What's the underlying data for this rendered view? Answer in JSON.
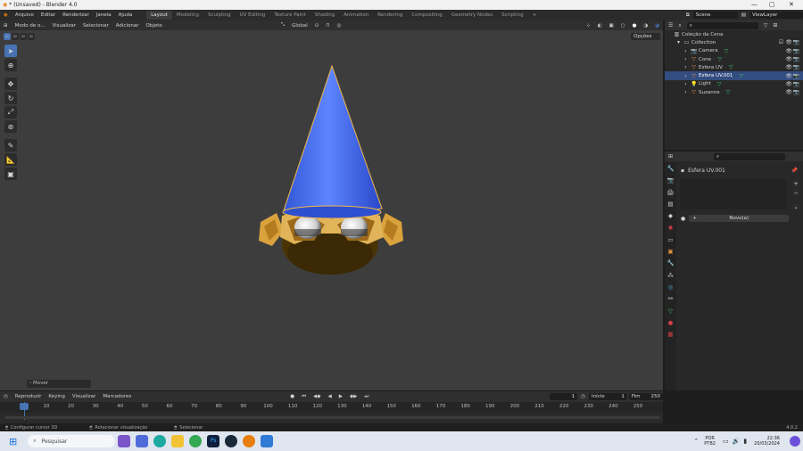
{
  "window": {
    "title": "* (Unsaved) - Blender 4.0"
  },
  "menu": [
    "Arquivo",
    "Editar",
    "Renderizar",
    "Janela",
    "Ajuda"
  ],
  "workspaces": [
    "Layout",
    "Modeling",
    "Sculpting",
    "UV Editing",
    "Texture Paint",
    "Shading",
    "Animation",
    "Rendering",
    "Compositing",
    "Geometry Nodes",
    "Scripting"
  ],
  "active_workspace": "Layout",
  "scene": {
    "label": "Scene",
    "viewlayer": "ViewLayer"
  },
  "viewport_header": {
    "mode": "Modo de o...",
    "items": [
      "Visualizar",
      "Selecionar",
      "Adicionar",
      "Objeto"
    ],
    "orientation": "Global",
    "options": "Opções"
  },
  "operator_panel": "Mover",
  "outliner": {
    "root": "Coleção da Cena",
    "collection": "Collection",
    "items": [
      {
        "name": "Camera",
        "icon": "camera-icon",
        "color": "#e0923a"
      },
      {
        "name": "Cone",
        "icon": "mesh-icon",
        "color": "#e0923a"
      },
      {
        "name": "Esfera UV",
        "icon": "mesh-icon",
        "color": "#e0923a"
      },
      {
        "name": "Esfera UV.001",
        "icon": "mesh-icon",
        "color": "#e0923a",
        "selected": true
      },
      {
        "name": "Light",
        "icon": "light-icon",
        "color": "#e0923a"
      },
      {
        "name": "Suzanne",
        "icon": "mesh-icon",
        "color": "#e0923a"
      }
    ]
  },
  "properties": {
    "object_name": "Esfera UV.001",
    "new_button": "Novo(a)"
  },
  "timeline": {
    "items": [
      "Reproduzir",
      "Keying",
      "Visualizar",
      "Marcadores"
    ],
    "current_frame": "1",
    "start_label": "Início",
    "start": "1",
    "end_label": "Fim",
    "end": "250",
    "ruler": [
      "1",
      "10",
      "20",
      "30",
      "40",
      "50",
      "60",
      "70",
      "80",
      "90",
      "100",
      "110",
      "120",
      "130",
      "140",
      "150",
      "160",
      "170",
      "180",
      "190",
      "200",
      "210",
      "220",
      "230",
      "240",
      "250"
    ]
  },
  "status": {
    "left": "Configurar cursor 3D",
    "mid": "Rotacionar visualização",
    "right": "Selecionar",
    "version": "4.0.2"
  },
  "taskbar": {
    "search": "Pesquisar",
    "lang1": "POR",
    "lang2": "PTB2",
    "time": "22:36",
    "date": "20/03/2024"
  },
  "colors": {
    "accent": "#4772b3",
    "selected_row": "#334d80",
    "viewport": "#3d3d3d",
    "cone_blue": "#3e63e8"
  }
}
